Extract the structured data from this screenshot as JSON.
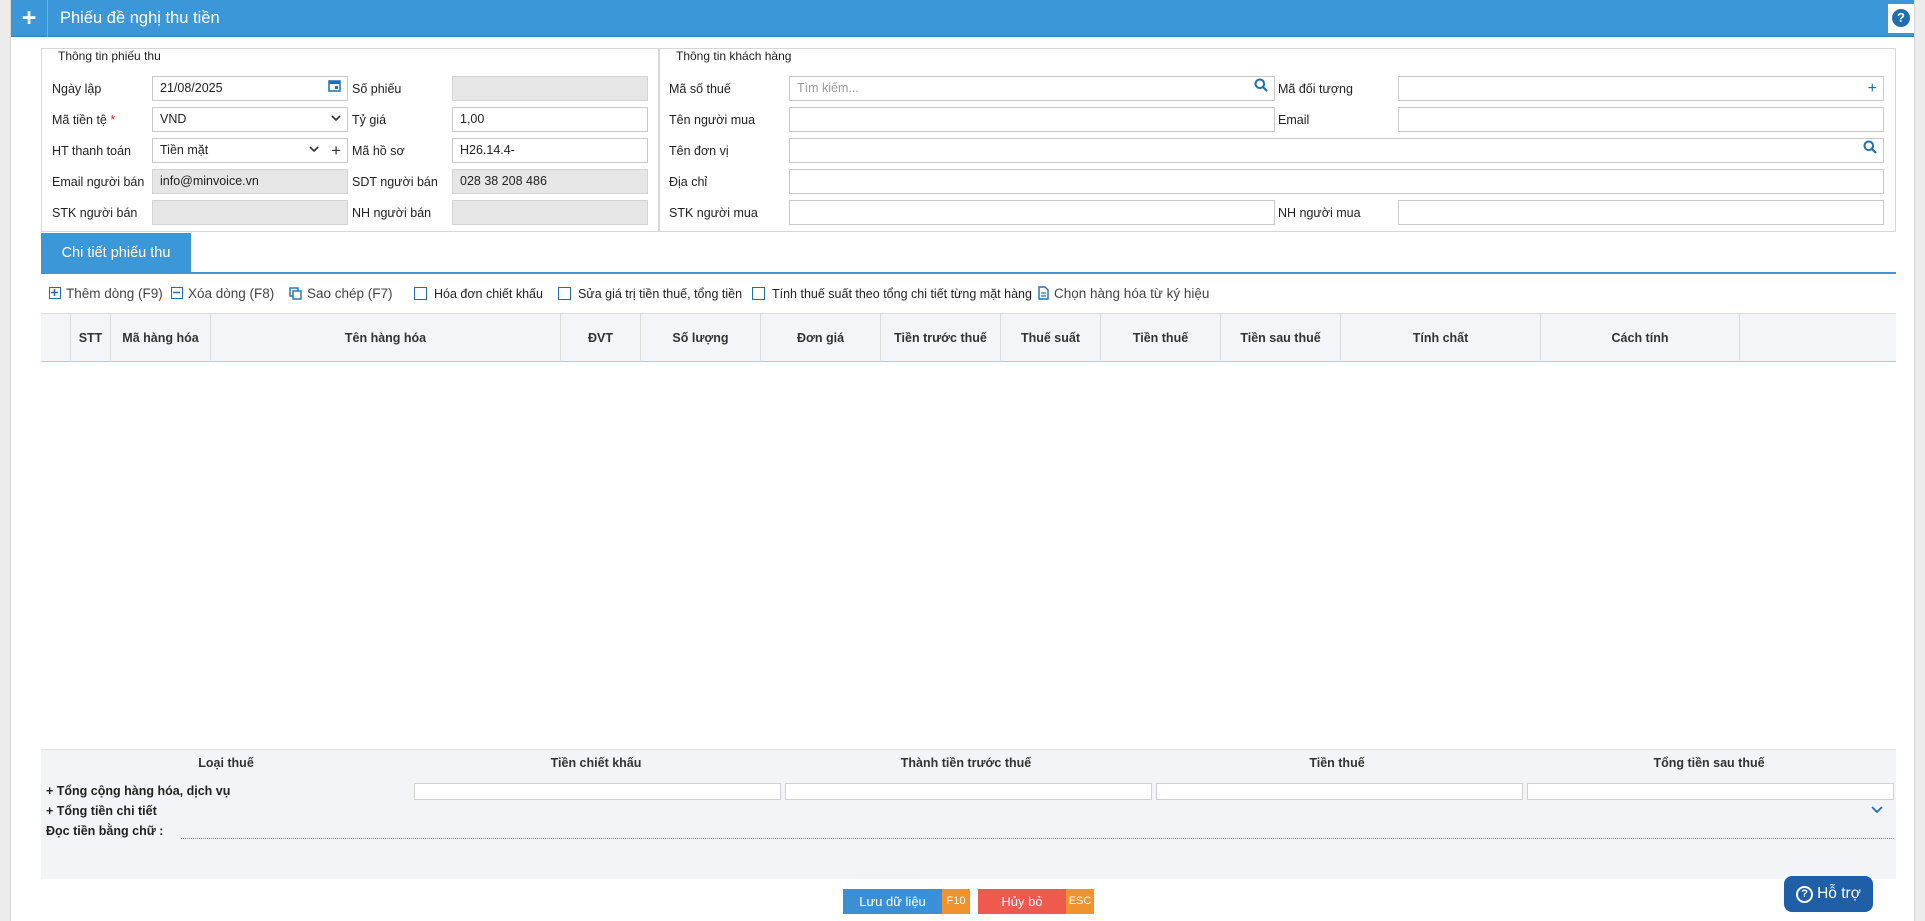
{
  "window": {
    "title": "Phiếu đề nghị thu tiền"
  },
  "receipt_info": {
    "legend": "Thông tin phiếu thu",
    "date_label": "Ngày lập",
    "date_value": "21/08/2025",
    "number_label": "Số phiếu",
    "number_value": "",
    "currency_label": "Mã tiền tệ",
    "currency_required": "*",
    "currency_value": "VND",
    "rate_label": "Tỷ giá",
    "rate_value": "1,00",
    "payment_label": "HT thanh toán",
    "payment_value": "Tiền mặt",
    "file_label": "Mã hồ sơ",
    "file_value": "H26.14.4-",
    "seller_email_label": "Email người bán",
    "seller_email_value": "info@minvoice.vn",
    "seller_phone_label": "SDT người bán",
    "seller_phone_value": "028 38 208 486",
    "seller_account_label": "STK người bán",
    "seller_account_value": "",
    "seller_bank_label": "NH người bán",
    "seller_bank_value": ""
  },
  "customer_info": {
    "legend": "Thông tin khách hàng",
    "tax_label": "Mã số thuế",
    "tax_placeholder": "Tìm kiếm...",
    "object_label": "Mã đối tượng",
    "object_value": "",
    "buyer_label": "Tên người mua",
    "buyer_value": "",
    "email_label": "Email",
    "email_value": "",
    "unit_label": "Tên đơn vị",
    "unit_value": "",
    "address_label": "Địa chỉ",
    "address_value": "",
    "buyer_account_label": "STK người mua",
    "buyer_account_value": "",
    "buyer_bank_label": "NH người mua",
    "buyer_bank_value": ""
  },
  "tab": {
    "label": "Chi tiết phiếu thu"
  },
  "toolbar": {
    "add_row": "Thêm dòng (F9)",
    "delete_row": "Xóa dòng (F8)",
    "copy": "Sao chép (F7)",
    "discount_invoice": "Hóa đơn chiết khấu",
    "edit_tax_total": "Sửa giá trị tiền thuế, tổng tiền",
    "tax_by_detail": "Tính thuế suất theo tổng chi tiết từng mặt hàng",
    "choose_goods": "Chọn hàng hóa từ ký hiệu"
  },
  "grid": {
    "columns": [
      "STT",
      "Mã hàng hóa",
      "Tên hàng hóa",
      "ĐVT",
      "Số lượng",
      "Đơn giá",
      "Tiền trước thuế",
      "Thuế suất",
      "Tiền thuế",
      "Tiền sau thuế",
      "Tính chất",
      "Cách tính"
    ],
    "rows": []
  },
  "summary": {
    "headers": [
      "Loại thuế",
      "Tiền chiết khấu",
      "Thành tiền trước thuế",
      "Tiền thuế",
      "Tổng tiền sau thuế"
    ],
    "total_goods_label": "+ Tổng cộng hàng hóa, dịch vụ",
    "total_detail_label": "+ Tổng tiền chi tiết",
    "read_amount_label": "Đọc tiền bằng chữ :"
  },
  "buttons": {
    "save_label": "Lưu dữ liệu",
    "save_key": "F10",
    "cancel_label": "Hủy bỏ",
    "cancel_key": "ESC",
    "support_label": "Hỗ trợ"
  },
  "colors": {
    "primary": "#3c97d8",
    "save": "#3a8fd6",
    "cancel": "#ef5a4f",
    "key": "#f0922e",
    "support": "#1f5fa8"
  }
}
